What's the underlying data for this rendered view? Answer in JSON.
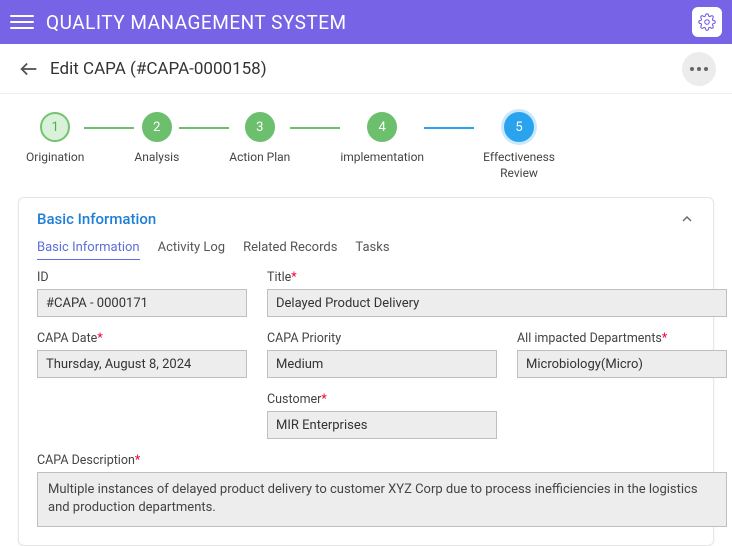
{
  "header": {
    "app_title": "QUALITY MANAGEMENT SYSTEM"
  },
  "page": {
    "title": "Edit CAPA (#CAPA-0000158)"
  },
  "stepper": {
    "s1": {
      "num": "1",
      "label": "Origination"
    },
    "s2": {
      "num": "2",
      "label": "Analysis"
    },
    "s3": {
      "num": "3",
      "label": "Action Plan"
    },
    "s4": {
      "num": "4",
      "label": "implementation"
    },
    "s5": {
      "num": "5",
      "label": "Effectiveness Review"
    }
  },
  "card": {
    "title": "Basic Information"
  },
  "tabs": {
    "t1": "Basic Information",
    "t2": "Activity Log",
    "t3": "Related Records",
    "t4": "Tasks"
  },
  "form": {
    "id_label": "ID",
    "id_value": "#CAPA - 0000171",
    "title_label": "Title",
    "title_value": "Delayed Product Delivery",
    "date_label": "CAPA Date",
    "date_value": "Thursday, August 8, 2024",
    "priority_label": "CAPA Priority",
    "priority_value": "Medium",
    "dept_label": "All impacted Departments",
    "dept_value": "Microbiology(Micro)",
    "customer_label": "Customer",
    "customer_value": "MIR Enterprises",
    "desc_label": "CAPA Description",
    "desc_value": "Multiple instances of delayed product delivery to customer XYZ Corp due to process inefficiencies in the logistics and production departments."
  }
}
